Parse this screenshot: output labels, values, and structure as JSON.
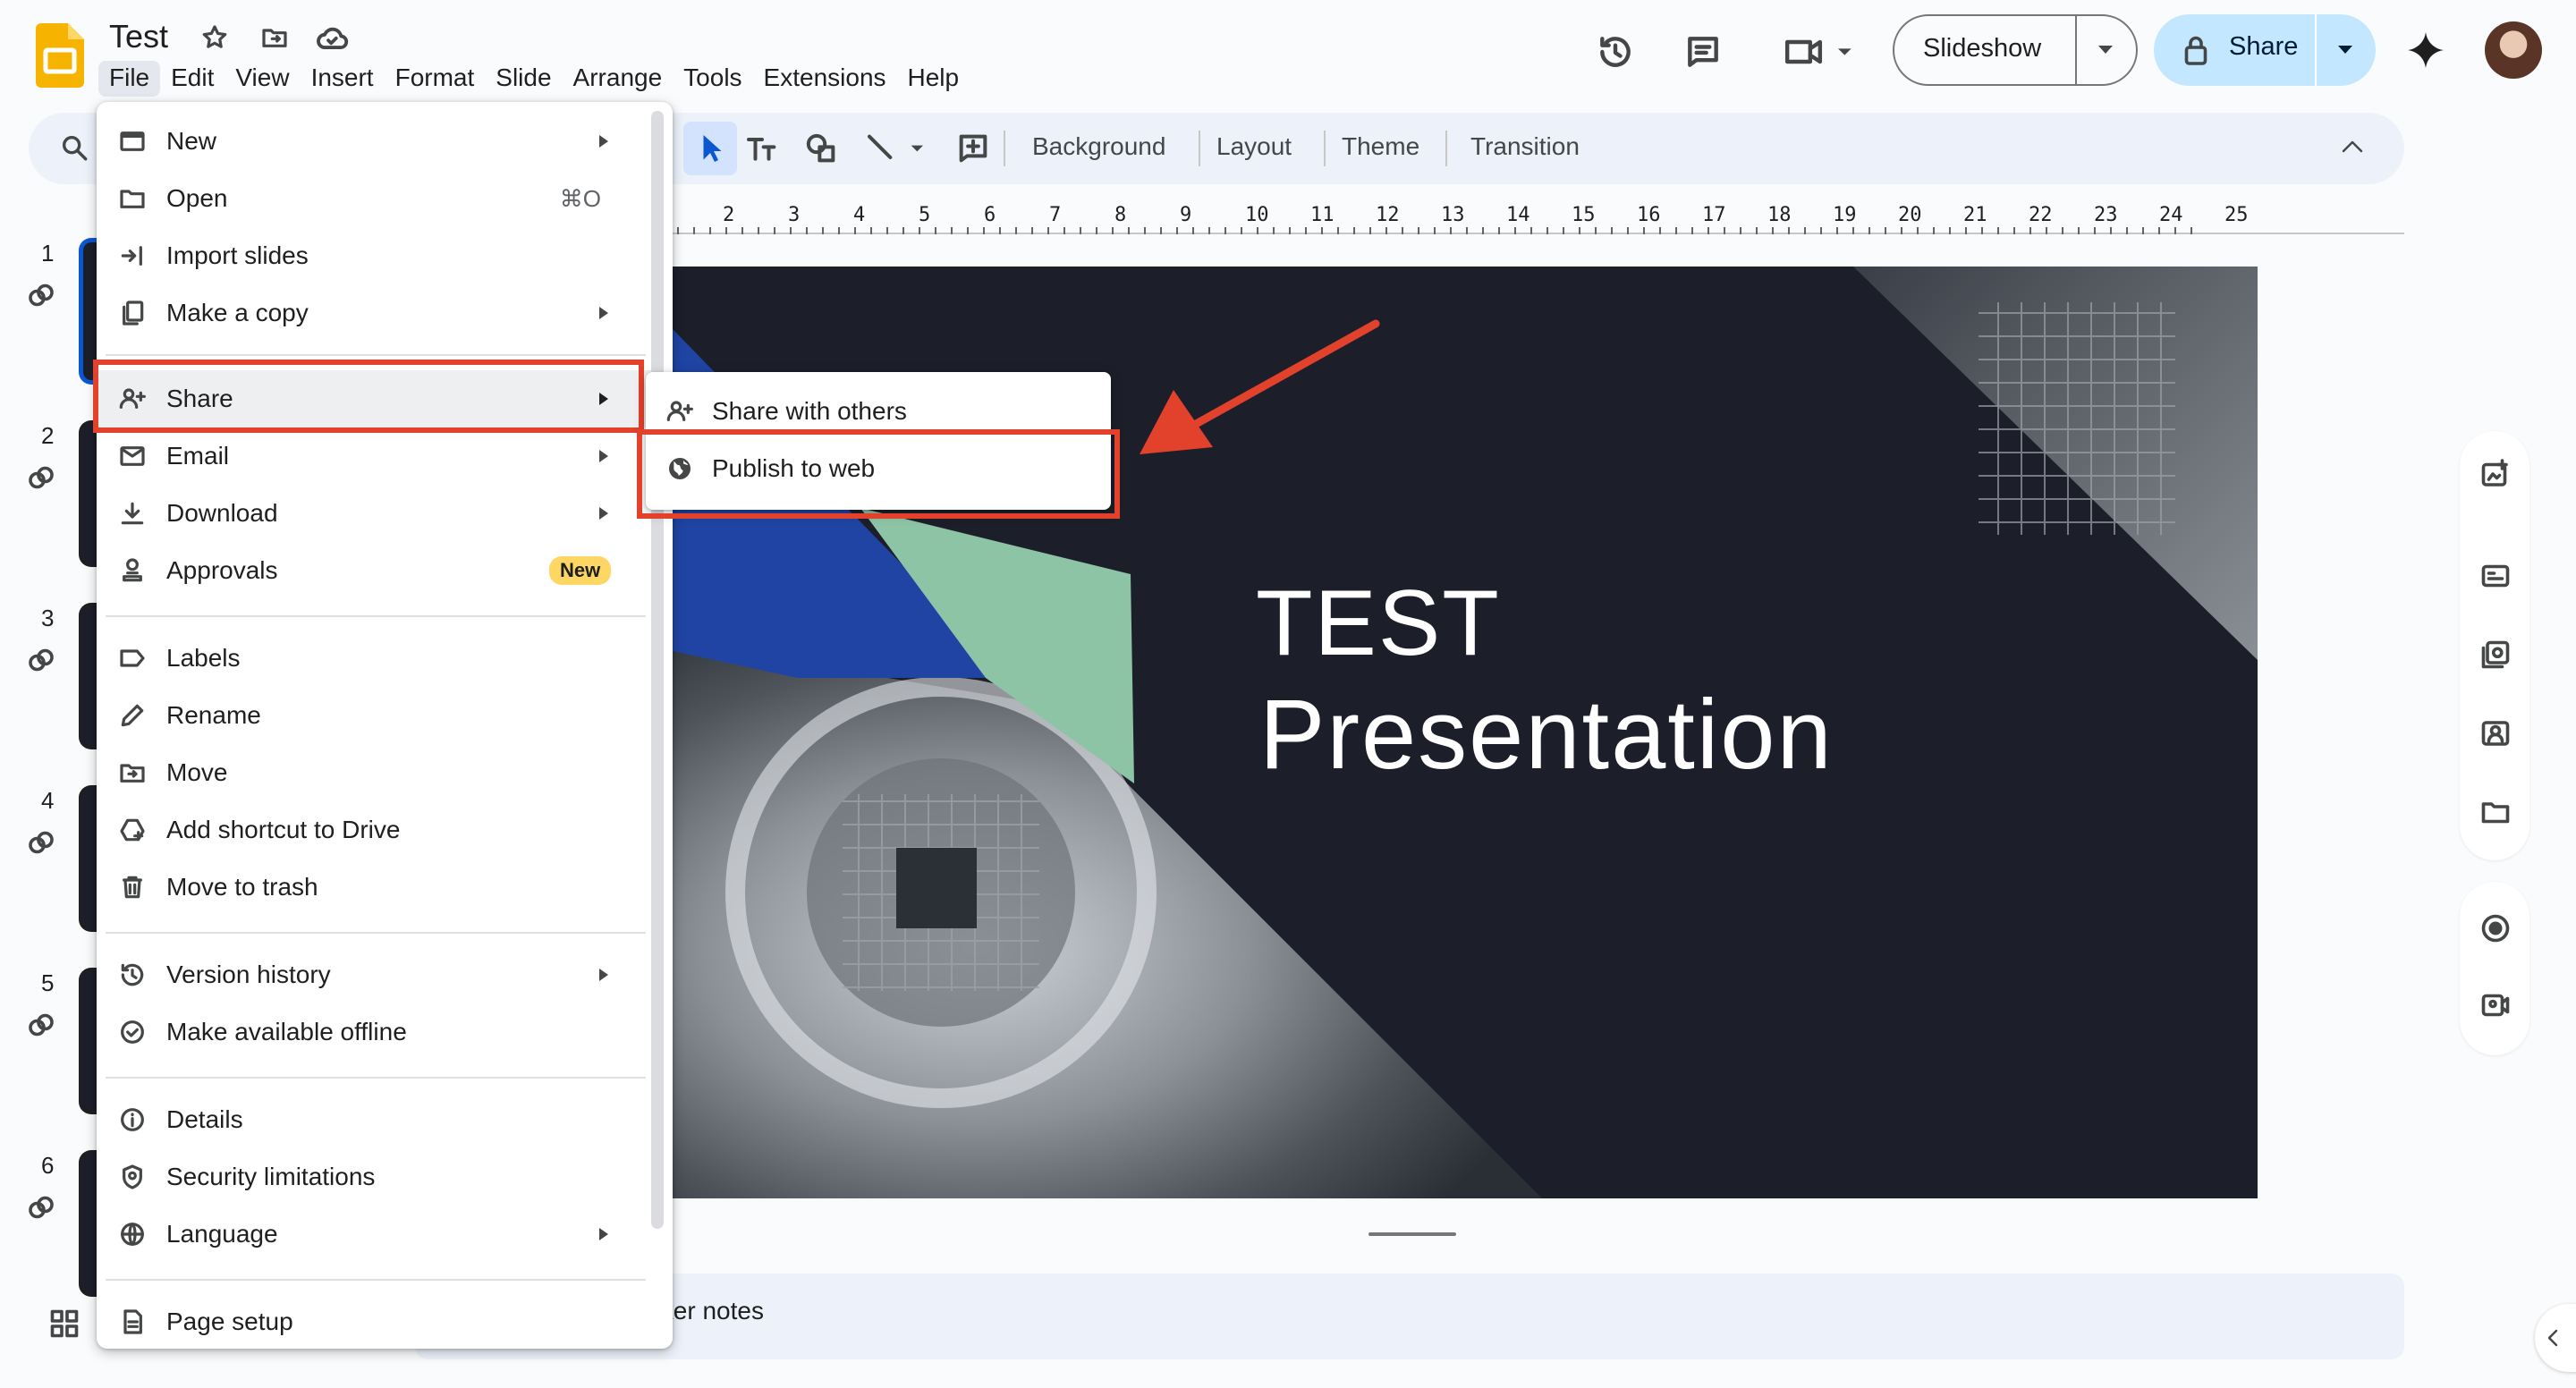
{
  "header": {
    "doc_title": "Test",
    "menus": [
      "File",
      "Edit",
      "View",
      "Insert",
      "Format",
      "Slide",
      "Arrange",
      "Tools",
      "Extensions",
      "Help"
    ],
    "slideshow_label": "Slideshow",
    "share_label": "Share"
  },
  "toolbar": {
    "background_label": "Background",
    "layout_label": "Layout",
    "theme_label": "Theme",
    "transition_label": "Transition"
  },
  "ruler": [
    "2",
    "3",
    "4",
    "5",
    "6",
    "7",
    "8",
    "9",
    "10",
    "11",
    "12",
    "13",
    "14",
    "15",
    "16",
    "17",
    "18",
    "19",
    "20",
    "21",
    "22",
    "23",
    "24",
    "25"
  ],
  "filmstrip": [
    "1",
    "2",
    "3",
    "4",
    "5",
    "6"
  ],
  "slide": {
    "title_line1": "TEST",
    "title_line2": "Presentation"
  },
  "speaker_notes": "Click to add speaker notes",
  "file_menu": {
    "new": "New",
    "open": "Open",
    "open_shortcut": "⌘O",
    "import_slides": "Import slides",
    "make_copy": "Make a copy",
    "share": "Share",
    "email": "Email",
    "download": "Download",
    "approvals": "Approvals",
    "approvals_badge": "New",
    "labels": "Labels",
    "rename": "Rename",
    "move": "Move",
    "add_shortcut": "Add shortcut to Drive",
    "move_to_trash": "Move to trash",
    "version_history": "Version history",
    "make_offline": "Make available offline",
    "details": "Details",
    "security_limitations": "Security limitations",
    "language": "Language",
    "page_setup": "Page setup"
  },
  "share_submenu": {
    "share_with_others": "Share with others",
    "publish_to_web": "Publish to web"
  },
  "colors": {
    "accent_blue": "#c2e7ff",
    "highlight_red": "#e2412b",
    "slide_dark": "#1c1f2a",
    "slide_blue": "#1f44a3",
    "slide_green": "#8ec4a6",
    "badge_yellow": "#fdd663"
  }
}
